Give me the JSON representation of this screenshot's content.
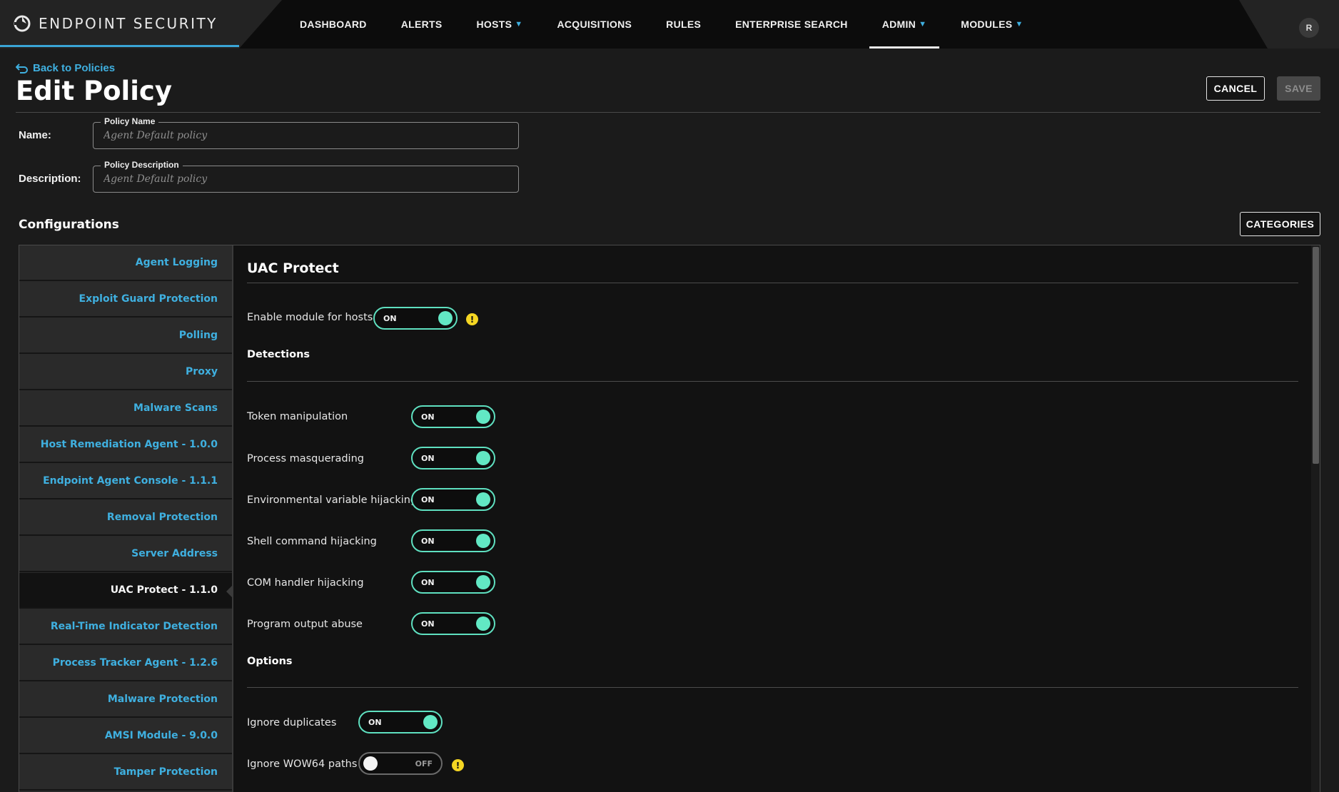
{
  "brand": {
    "name": "ENDPOINT SECURITY",
    "logo_icon": "endpoint-logo-icon"
  },
  "nav": {
    "items": [
      {
        "label": "DASHBOARD",
        "dropdown": false
      },
      {
        "label": "ALERTS",
        "dropdown": false
      },
      {
        "label": "HOSTS",
        "dropdown": true
      },
      {
        "label": "ACQUISITIONS",
        "dropdown": false
      },
      {
        "label": "RULES",
        "dropdown": false
      },
      {
        "label": "ENTERPRISE SEARCH",
        "dropdown": false
      },
      {
        "label": "ADMIN",
        "dropdown": true,
        "active": true
      },
      {
        "label": "MODULES",
        "dropdown": true
      }
    ],
    "chevron": "⌄"
  },
  "user": {
    "initial": "R"
  },
  "header": {
    "back_label": "Back to Policies",
    "title": "Edit Policy",
    "cancel_label": "CANCEL",
    "save_label": "SAVE"
  },
  "form": {
    "name_label": "Name:",
    "name_legend": "Policy Name",
    "name_value": "Agent Default policy",
    "description_label": "Description:",
    "description_legend": "Policy Description",
    "description_value": "Agent Default policy"
  },
  "configurations": {
    "title": "Configurations",
    "categories_label": "CATEGORIES",
    "sidebar": [
      "Agent Logging",
      "Exploit Guard Protection",
      "Polling",
      "Proxy",
      "Malware Scans",
      "Host Remediation Agent - 1.0.0",
      "Endpoint Agent Console - 1.1.1",
      "Removal Protection",
      "Server Address",
      "UAC Protect - 1.1.0",
      "Real-Time Indicator Detection",
      "Process Tracker Agent - 1.2.6",
      "Malware Protection",
      "AMSI Module - 9.0.0",
      "Tamper Protection"
    ],
    "active_index": 9
  },
  "module": {
    "title": "UAC Protect",
    "enable_label": "Enable module for hosts",
    "enable_state": "ON",
    "detections_title": "Detections",
    "detections": [
      {
        "label": "Token manipulation",
        "state": "ON"
      },
      {
        "label": "Process masquerading",
        "state": "ON"
      },
      {
        "label": "Environmental variable hijacking",
        "state": "ON"
      },
      {
        "label": "Shell command hijacking",
        "state": "ON"
      },
      {
        "label": "COM handler hijacking",
        "state": "ON"
      },
      {
        "label": "Program output abuse",
        "state": "ON"
      }
    ],
    "options_title": "Options",
    "options": [
      {
        "label": "Ignore duplicates",
        "state": "ON"
      },
      {
        "label": "Ignore WOW64 paths",
        "state": "OFF"
      }
    ],
    "warning_glyph": "!"
  },
  "colors": {
    "accent": "#3fb0e0",
    "toggle_on": "#62e8c4",
    "warning": "#f5d623"
  }
}
